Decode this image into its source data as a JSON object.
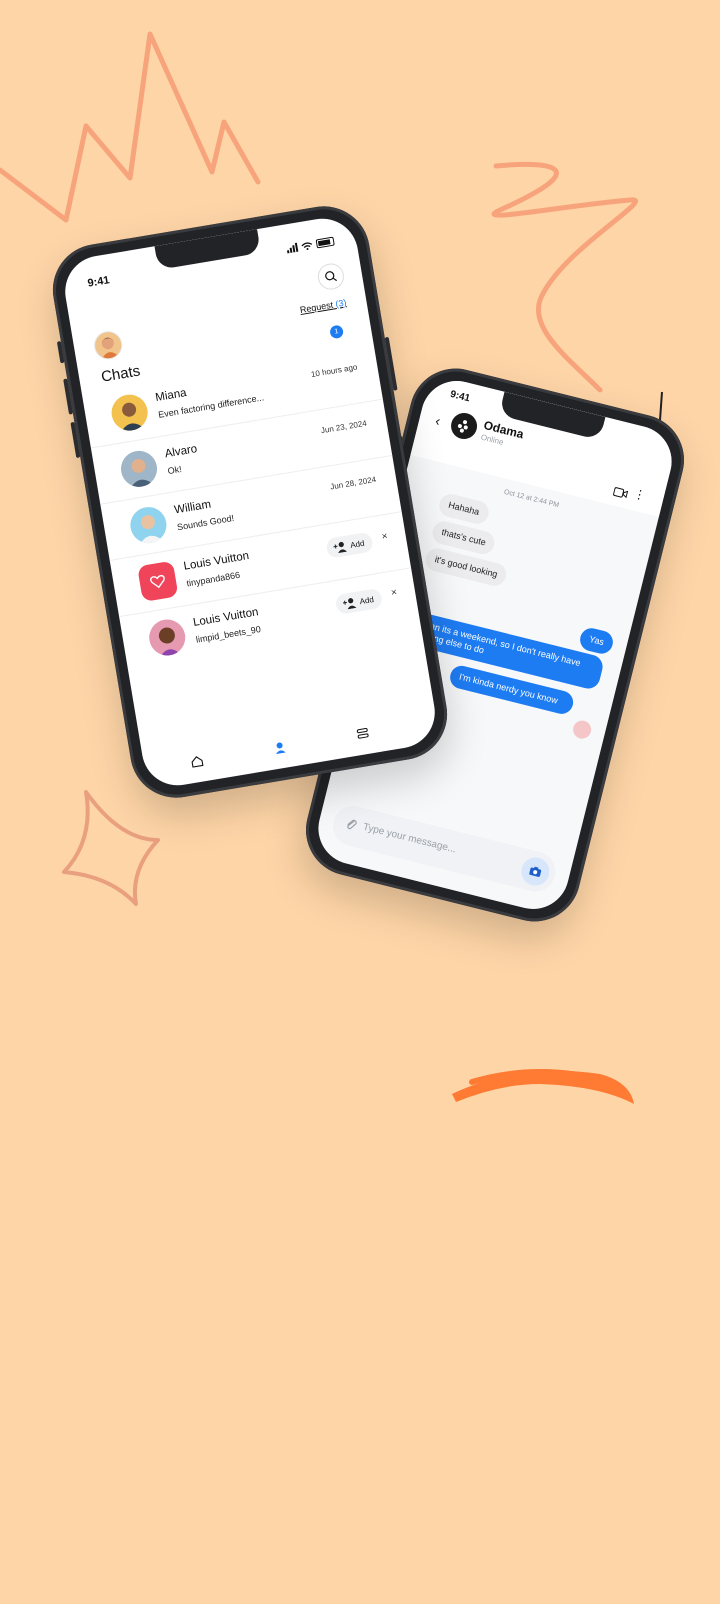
{
  "phone1": {
    "status_time": "9:41",
    "request_label": "Request",
    "request_count": "(3)",
    "title": "Chats",
    "unread_badge": "1",
    "chats": [
      {
        "name": "Miana",
        "preview": "Even factoring difference...",
        "meta": "10 hours ago"
      },
      {
        "name": "Alvaro",
        "preview": "Ok!",
        "meta": "Jun 23, 2024"
      },
      {
        "name": "William",
        "preview": "Sounds Good!",
        "meta": "Jun 28, 2024"
      }
    ],
    "requests": [
      {
        "name": "Louis Vuitton",
        "handle": "tinypanda866",
        "add_label": "Add",
        "dismiss": "×"
      },
      {
        "name": "Louis Vuitton",
        "handle": "limpid_beets_90",
        "add_label": "Add",
        "dismiss": "×"
      }
    ],
    "icons": [
      "search-icon",
      "home-icon",
      "profile-icon",
      "stack-icon"
    ]
  },
  "phone2": {
    "status_time": "9:41",
    "contact_name": "Odama",
    "contact_status": "Online",
    "date_stamp": "Oct 12 at 2:44 PM",
    "incoming": [
      "Hahaha",
      "thats's cute",
      "it's good looking"
    ],
    "outgoing": [
      "Yas",
      "I mean its a weekend, so I don't really have anything else to do",
      "I'm kinda nerdy you know"
    ],
    "composer_placeholder": "Type your message...",
    "icons": [
      "back-icon",
      "video-call-icon",
      "more-icon",
      "paperclip-icon",
      "camera-icon"
    ]
  },
  "colors": {
    "background": "#FED5A7",
    "accent_blue": "#1e7cf3",
    "doodle": "#F7A47C",
    "brush": "#FF7A33"
  }
}
